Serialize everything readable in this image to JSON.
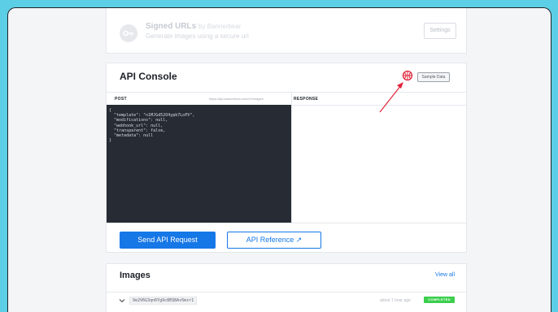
{
  "signed_urls": {
    "title": "Signed URLs",
    "by": "by Bannerbear",
    "subtitle": "Generate images using a secure url",
    "settings_label": "Settings"
  },
  "api_console": {
    "title": "API Console",
    "sample_data_label": "Sample Data",
    "post_label": "POST",
    "endpoint": "https://api.bannerbear.com/v2/images",
    "response_label": "RESPONSE",
    "code_lines": [
      "{",
      "  \"template\": \"n1MJGd52O4ypb7LoPV\",",
      "  \"modifications\": null,",
      "  \"webhook_url\": null,",
      "  \"transparent\": false,",
      "  \"metadata\": null",
      "}"
    ],
    "send_button_label": "Send API Request",
    "reference_button_label": "API Reference ↗"
  },
  "images": {
    "title": "Images",
    "view_all_label": "View all",
    "rows": [
      {
        "id": "9e2V6G3qn6Yg9c8EQ8Av5mxr1",
        "time": "about 1 hour ago",
        "status": "COMPLETED"
      }
    ]
  },
  "colors": {
    "background": "#5ccfe6",
    "accent": "#1677e6",
    "success": "#3ccf4e",
    "annotation": "#e0243a"
  },
  "icons": [
    "key-icon",
    "basketball-icon",
    "chevron-down-icon",
    "external-link-icon"
  ]
}
